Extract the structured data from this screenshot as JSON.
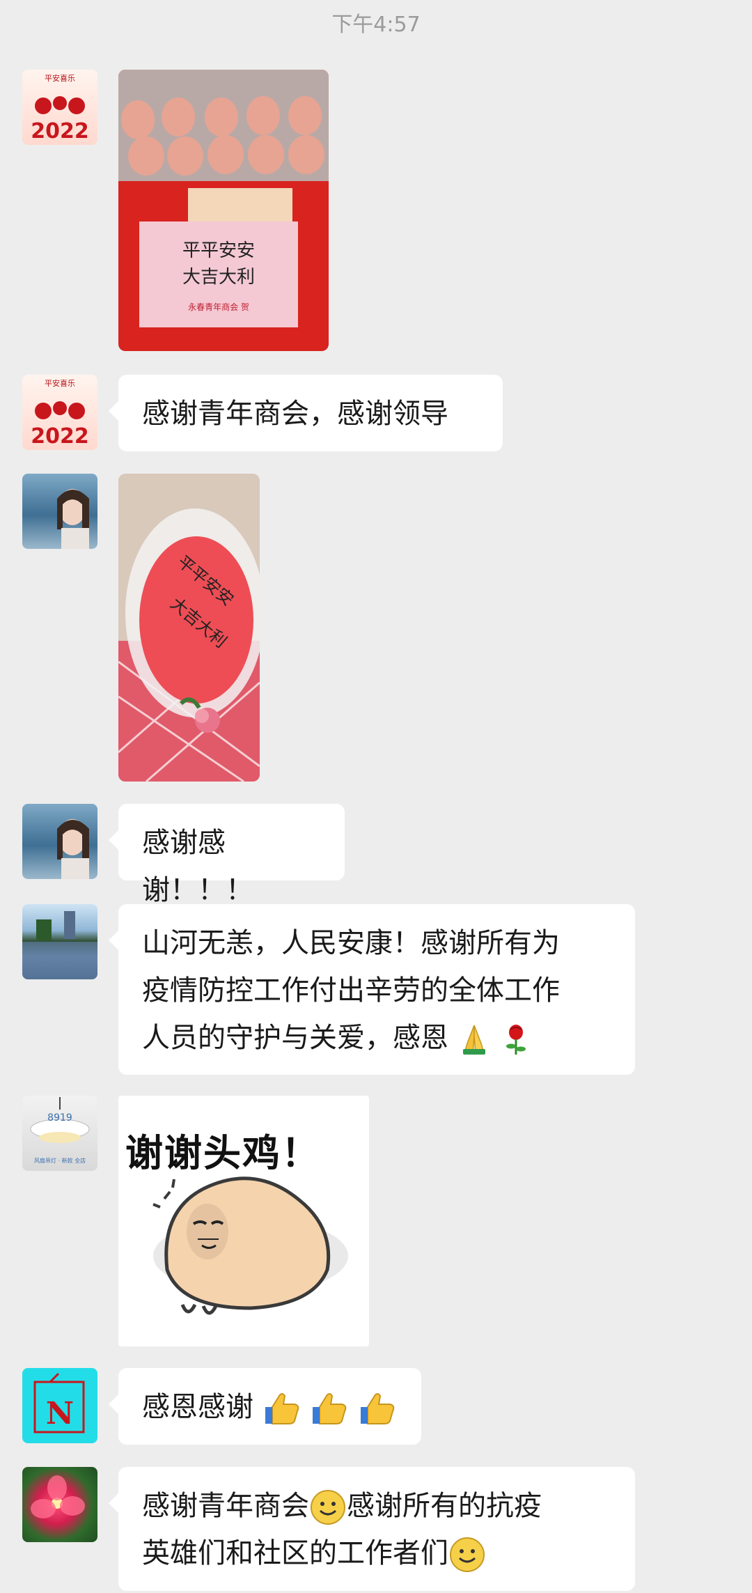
{
  "timestamp": "下午4:57",
  "messages": [
    {
      "type": "image",
      "description_icon": "egg-gift-photo",
      "label": "平平安安 大吉大利",
      "sub": "永春青年商会 贺"
    },
    {
      "type": "text",
      "text": "感谢青年商会，感谢领导"
    },
    {
      "type": "image",
      "description_icon": "gift-bag-photo",
      "label": "平平安安 大吉大利"
    },
    {
      "type": "text",
      "text": "感谢感谢！！！"
    },
    {
      "type": "text",
      "lines": [
        "山河无恙，人民安康！感谢所有为",
        "疫情防控工作付出辛劳的全体工作",
        "人员的守护与关爱，感恩"
      ]
    },
    {
      "type": "sticker",
      "text": "谢谢头鸡！"
    },
    {
      "type": "text",
      "text": "感恩感谢"
    },
    {
      "type": "text",
      "lines": [
        "感谢青年商会",
        "感谢所有的抗疫",
        "英雄们和社区的工作者们"
      ]
    }
  ],
  "avatars": {
    "a1_caption": "平安喜乐",
    "a1_year": "2022",
    "lamp_caption": "8919",
    "lamp_sub": "风扇吊灯 · 新款 全店"
  },
  "colors": {
    "background": "#ededed",
    "bubble": "#ffffff",
    "timestamp": "#9b9b9b"
  }
}
